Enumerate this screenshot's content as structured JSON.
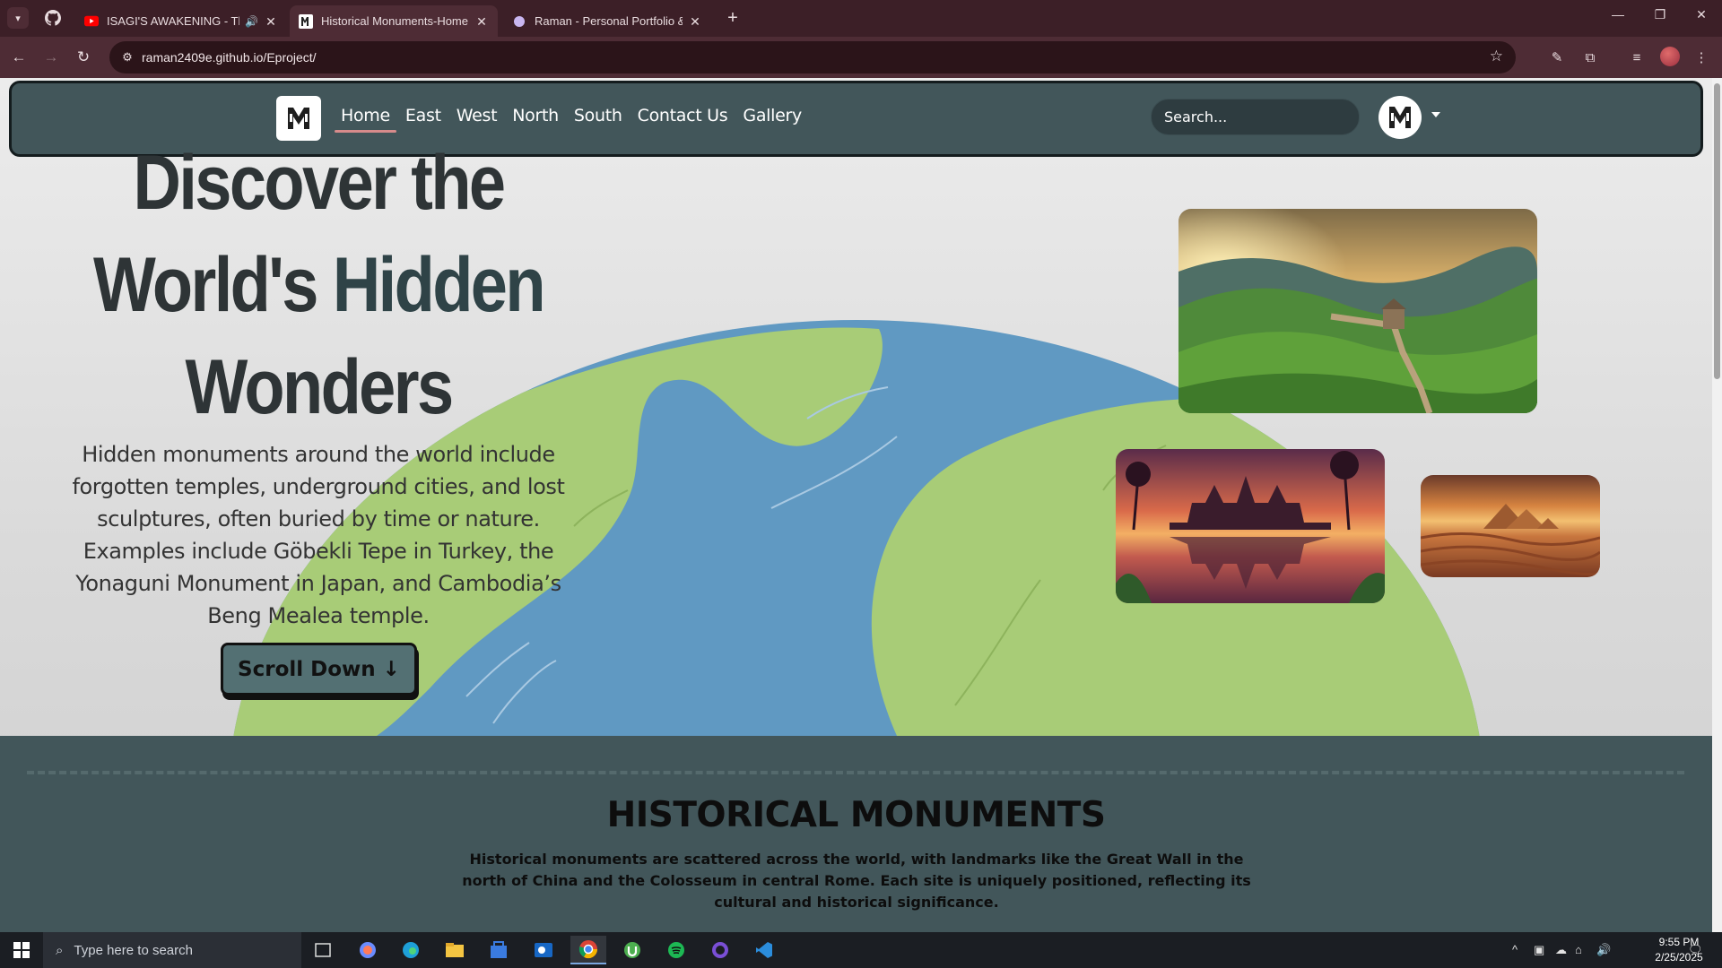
{
  "browser": {
    "tabs": [
      {
        "title": "ISAGI'S AWAKENING - This",
        "favicon": "youtube-icon",
        "audio": true,
        "active": false
      },
      {
        "title": "Historical Monuments-Home",
        "favicon": "site-logo-icon",
        "audio": false,
        "active": true
      },
      {
        "title": "Raman - Personal Portfolio & R",
        "favicon": "portfolio-icon",
        "audio": false,
        "active": false
      }
    ],
    "url": "raman2409e.github.io/Eproject/"
  },
  "site": {
    "nav": {
      "links": [
        "Home",
        "East",
        "West",
        "North",
        "South",
        "Contact Us",
        "Gallery"
      ],
      "active": "Home",
      "search_placeholder": "Search..."
    },
    "hero": {
      "title_line1": "Discover the",
      "title_line2a": "World's ",
      "title_line2b": "Hidden",
      "title_line3": "Wonders",
      "description": "Hidden monuments around the world include forgotten temples, underground cities, and lost sculptures, often buried by time or nature. Examples include Göbekli Tepe in Turkey, the Yonaguni Monument in Japan, and Cambodia’s Beng Mealea temple.",
      "button": "Scroll Down ↓"
    },
    "monuments": {
      "title": "HISTORICAL MONUMENTS",
      "description": "Historical monuments are scattered across the world, with landmarks like the Great Wall in the north of China and the Colosseum in central Rome. Each site is uniquely positioned, reflecting its cultural and historical significance."
    }
  },
  "taskbar": {
    "search_placeholder": "Type here to search",
    "time": "9:55 PM",
    "date": "2/25/2025"
  },
  "colors": {
    "nav_bg": "#42565a",
    "earth_land": "#a8cc77",
    "earth_water": "#6099c2",
    "tab_bar": "#3c1f27"
  }
}
